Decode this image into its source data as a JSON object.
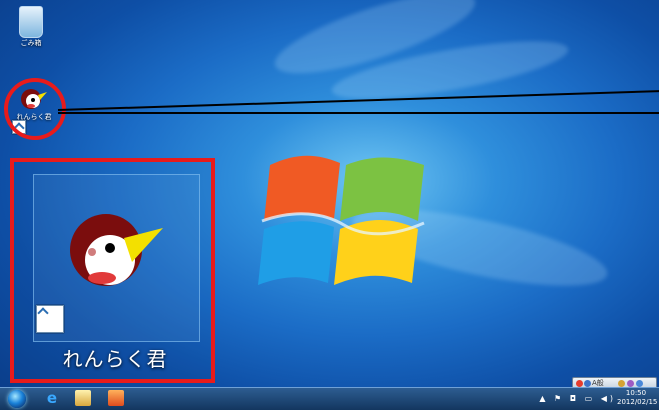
{
  "desktop": {
    "icons": {
      "recycle_bin_label": "ごみ箱",
      "renraku_small_label": "れんらく君",
      "renraku_large_label": "れんらく君"
    }
  },
  "taskbar": {
    "ie_glyph": "e",
    "tray_glyphs": "▲ ⚑ ◘ ▭ ◀)",
    "clock_time": "10:50",
    "clock_date": "2012/02/15"
  },
  "language_bar": {
    "label": "A般"
  },
  "colors": {
    "highlight": "#e81b1b",
    "taskbar_top": "#2d5d91",
    "taskbar_bottom": "#13365f"
  }
}
